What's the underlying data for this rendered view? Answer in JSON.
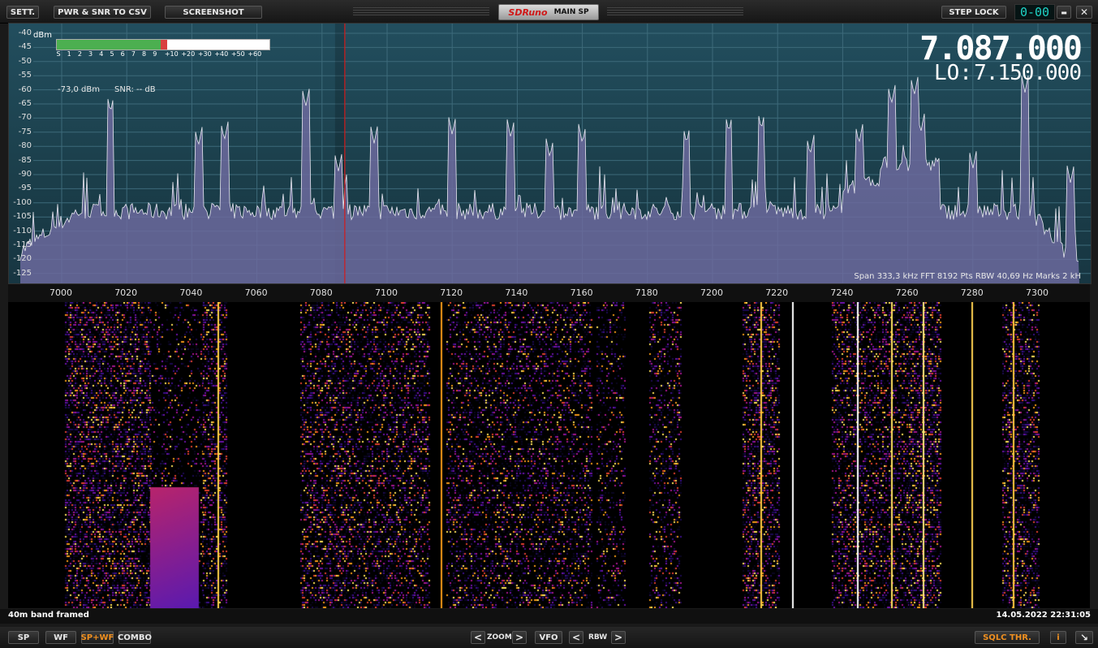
{
  "topbar": {
    "sett_label": "SETT.",
    "csv_label": "PWR & SNR TO CSV",
    "screenshot_label": "SCREENSHOT",
    "brand": "SDRuno",
    "panel_title": "MAIN SP",
    "step_lock_label": "STEP LOCK",
    "step_display": "0-00",
    "minimize_label": "▬",
    "close_label": "✕"
  },
  "spectrum": {
    "dbm_label": "dBm",
    "y_ticks": [
      "-40",
      "-45",
      "-50",
      "-55",
      "-60",
      "-65",
      "-70",
      "-75",
      "-80",
      "-85",
      "-90",
      "-95",
      "-100",
      "-105",
      "-110",
      "-115",
      "-120",
      "-125"
    ],
    "x_ticks": [
      "7000",
      "7020",
      "7040",
      "7060",
      "7080",
      "7100",
      "7120",
      "7140",
      "7160",
      "7180",
      "7200",
      "7220",
      "7240",
      "7260",
      "7280",
      "7300"
    ],
    "s_scale": [
      "S",
      "1",
      "2",
      "3",
      "4",
      "5",
      "6",
      "7",
      "8",
      "9",
      "+10",
      "+20",
      "+30",
      "+40",
      "+50",
      "+60"
    ],
    "s_meter_fraction": 0.49,
    "signal_level": "-73,0 dBm",
    "snr": "SNR: -- dB",
    "frequency": "7.087.000",
    "lo_label": "LO:",
    "lo_frequency": "7.150.000",
    "info": "Span 333,3 kHz   FFT 8192 Pts   RBW 40,69 Hz   Marks 2 kH",
    "tuned_khz": 7087,
    "fill_color": "#6c6a9e",
    "trace_color": "#e8e8f0",
    "marker_color": "#d41a1a"
  },
  "status": {
    "left_text": "40m band framed",
    "timestamp": "14.05.2022 22:31:05"
  },
  "bottombar": {
    "sp_label": "SP",
    "wf_label": "WF",
    "spwf_label": "SP+WF",
    "combo_label": "COMBO",
    "zoom_left": "<",
    "zoom_label": "ZOOM",
    "zoom_right": ">",
    "vfo_label": "VFO",
    "rbw_left": "<",
    "rbw_label": "RBW",
    "rbw_right": ">",
    "sqlc_label": "SQLC THR.",
    "info_label": "i",
    "resize_label": "↘"
  }
}
